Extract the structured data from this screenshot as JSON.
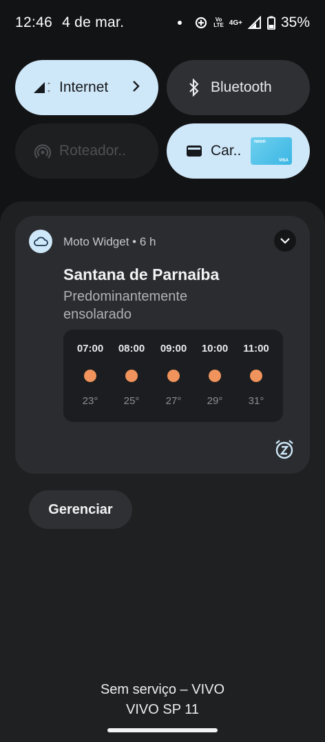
{
  "status_bar": {
    "time": "12:46",
    "date": "4 de mar.",
    "volte_top": "Vo",
    "volte_bottom": "LTE",
    "network": "4G+",
    "battery": "35%",
    "icons": [
      "notification-dot",
      "data-saver-icon",
      "volte-icon",
      "signal-icon",
      "battery-icon"
    ]
  },
  "quick_tiles": [
    {
      "label": "Internet",
      "icon": "signal-icon",
      "state": "on"
    },
    {
      "label": "Bluetooth",
      "icon": "bluetooth-icon",
      "state": "off"
    },
    {
      "label": "Roteador..",
      "icon": "hotspot-icon",
      "state": "unavailable"
    },
    {
      "label": "Car..",
      "icon": "wallet-icon",
      "state": "on",
      "card_brand": "neon",
      "card_network": "VISA"
    }
  ],
  "notification": {
    "app": "Moto Widget",
    "separator": "•",
    "age": "6 h",
    "title": "Santana de Parnaíba",
    "body": "Predominantemente ensolarado",
    "forecast": [
      {
        "hour": "07:00",
        "temp": "23°",
        "icon": "sun-icon"
      },
      {
        "hour": "08:00",
        "temp": "25°",
        "icon": "sun-icon"
      },
      {
        "hour": "09:00",
        "temp": "27°",
        "icon": "sun-icon"
      },
      {
        "hour": "10:00",
        "temp": "29°",
        "icon": "sun-icon"
      },
      {
        "hour": "11:00",
        "temp": "31°",
        "icon": "sun-icon"
      }
    ]
  },
  "manage_label": "Gerenciar",
  "carrier": {
    "line1": "Sem serviço – VIVO",
    "line2": "VIVO SP 11"
  },
  "colors": {
    "tile_active": "#cfe8f9",
    "tile_inactive": "#2e3033",
    "panel": "#1e2022",
    "sun": "#f0935c"
  }
}
